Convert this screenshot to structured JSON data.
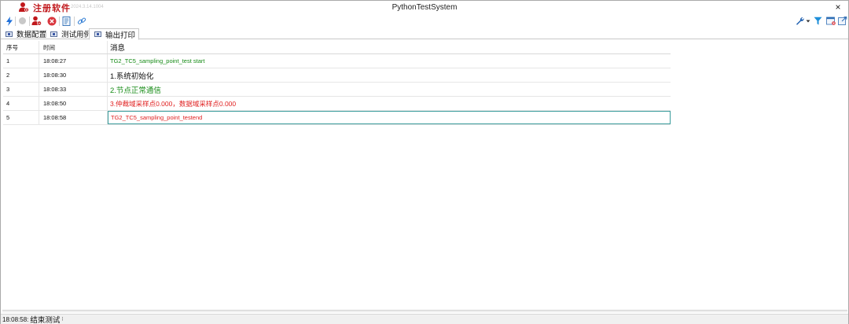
{
  "titlebar": {
    "registration_label": "注册软件",
    "build_label": "2024.3.14.1004",
    "window_title": "PythonTestSystem",
    "close_glyph": "×"
  },
  "toolbar": {
    "left_icons": [
      "lightning-icon",
      "circle-disabled-icon",
      "user-delete-icon",
      "stop-icon",
      "script-icon",
      "link-icon"
    ],
    "right_icons": [
      "wrench-icon",
      "filter-icon",
      "calendar-close-icon",
      "export-icon"
    ],
    "colors": {
      "lightning": "#1e6fd9",
      "stop": "#d9363e",
      "user": "#c0171b",
      "filter": "#1e8fd9"
    }
  },
  "tabs": [
    {
      "label": "数据配置",
      "active": false
    },
    {
      "label": "测试用例",
      "active": false
    },
    {
      "label": "输出打印",
      "active": true
    }
  ],
  "grid": {
    "headers": {
      "no": "序号",
      "time": "时间",
      "message": "消息"
    },
    "rows": [
      {
        "no": "1",
        "time": "18:08:27",
        "message": "TG2_TC5_sampling_point_test start",
        "color": "green",
        "size": "small"
      },
      {
        "no": "2",
        "time": "18:08:30",
        "message": "1.系统初始化",
        "color": "black",
        "size": "big"
      },
      {
        "no": "3",
        "time": "18:08:33",
        "message": "2.节点正常通信",
        "color": "green",
        "size": "big"
      },
      {
        "no": "4",
        "time": "18:08:50",
        "message": "3.仲裁域采样点0.000，数据域采样点0.000",
        "color": "red",
        "size": "mixed"
      },
      {
        "no": "5",
        "time": "18:08:58",
        "message": "TG2_TC5_sampling_point_testend",
        "color": "red",
        "size": "small",
        "selected": true
      }
    ]
  },
  "status": {
    "time": "18:08:58:",
    "text": "结束测试",
    "caret": "⁝"
  }
}
